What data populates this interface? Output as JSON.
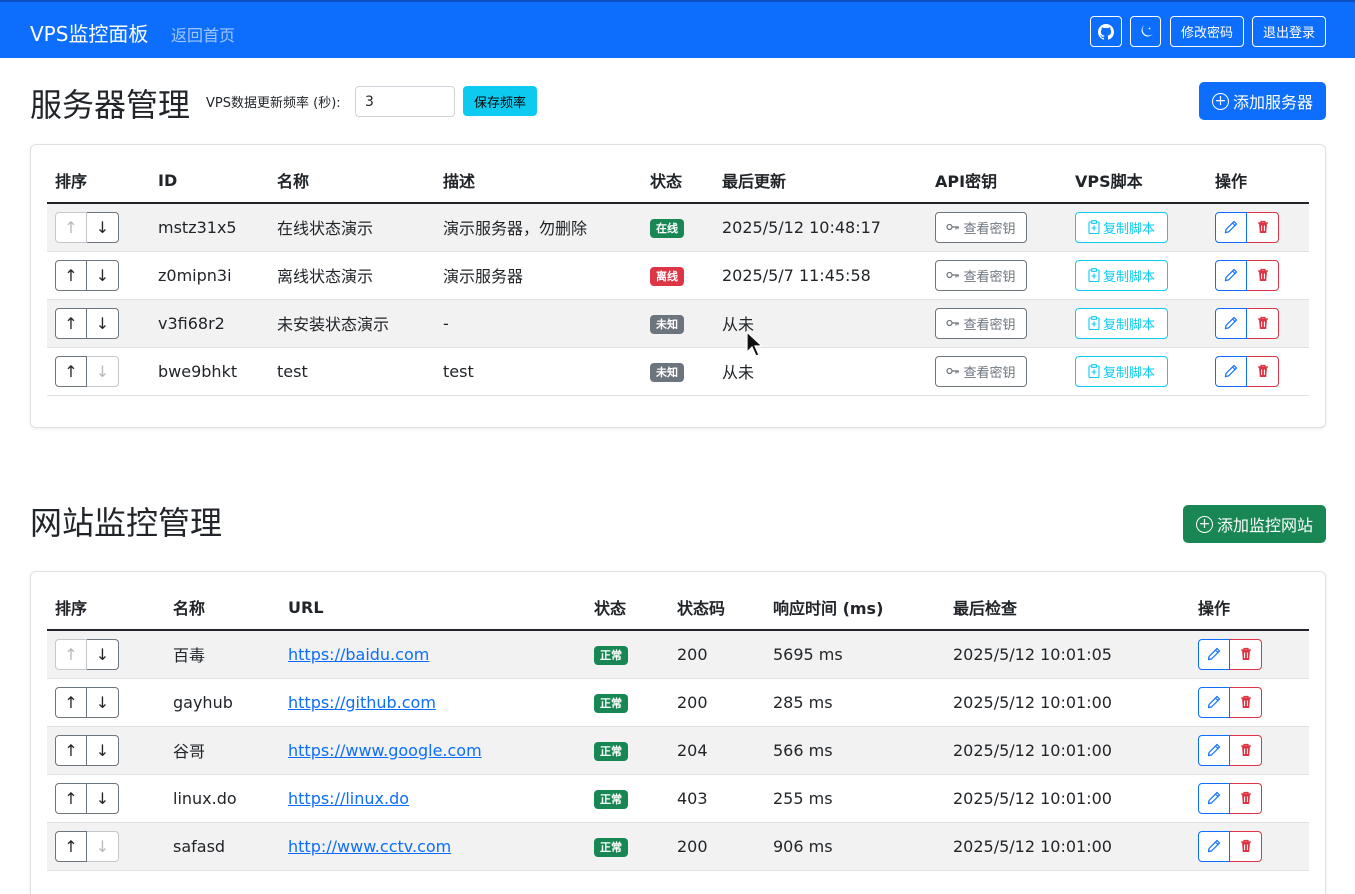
{
  "navbar": {
    "brand": "VPS监控面板",
    "home": "返回首页",
    "change_password": "修改密码",
    "logout": "退出登录"
  },
  "servers": {
    "title": "服务器管理",
    "freq_label": "VPS数据更新频率 (秒):",
    "freq_value": "3",
    "save_freq": "保存频率",
    "add_button": "添加服务器",
    "columns": [
      "排序",
      "ID",
      "名称",
      "描述",
      "状态",
      "最后更新",
      "API密钥",
      "VPS脚本",
      "操作"
    ],
    "view_key_label": "查看密钥",
    "copy_script_label": "复制脚本",
    "rows": [
      {
        "id": "mstz31x5",
        "name": "在线状态演示",
        "desc": "演示服务器，勿删除",
        "status": "在线",
        "updated": "2025/5/12 10:48:17"
      },
      {
        "id": "z0mipn3i",
        "name": "离线状态演示",
        "desc": "演示服务器",
        "status": "离线",
        "updated": "2025/5/7 11:45:58"
      },
      {
        "id": "v3fi68r2",
        "name": "未安装状态演示",
        "desc": "-",
        "status": "未知",
        "updated": "从未"
      },
      {
        "id": "bwe9bhkt",
        "name": "test",
        "desc": "test",
        "status": "未知",
        "updated": "从未"
      }
    ]
  },
  "sites": {
    "title": "网站监控管理",
    "add_button": "添加监控网站",
    "columns": [
      "排序",
      "名称",
      "URL",
      "状态",
      "状态码",
      "响应时间 (ms)",
      "最后检查",
      "操作"
    ],
    "rows": [
      {
        "name": "百毒",
        "url": "https://baidu.com",
        "status": "正常",
        "code": "200",
        "resp": "5695 ms",
        "checked": "2025/5/12 10:01:05"
      },
      {
        "name": "gayhub",
        "url": "https://github.com",
        "status": "正常",
        "code": "200",
        "resp": "285 ms",
        "checked": "2025/5/12 10:01:00"
      },
      {
        "name": "谷哥",
        "url": "https://www.google.com",
        "status": "正常",
        "code": "204",
        "resp": "566 ms",
        "checked": "2025/5/12 10:01:00"
      },
      {
        "name": "linux.do",
        "url": "https://linux.do",
        "status": "正常",
        "code": "403",
        "resp": "255 ms",
        "checked": "2025/5/12 10:01:00"
      },
      {
        "name": "safasd",
        "url": "http://www.cctv.com",
        "status": "正常",
        "code": "200",
        "resp": "906 ms",
        "checked": "2025/5/12 10:01:00"
      }
    ]
  },
  "colors": {
    "primary": "#0d6efd",
    "success": "#198754",
    "danger": "#dc3545",
    "secondary": "#6c757d",
    "info": "#0dcaf0"
  }
}
